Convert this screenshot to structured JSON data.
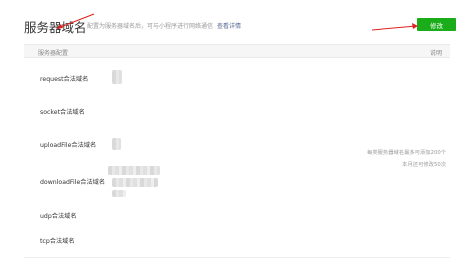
{
  "header": {
    "title": "服务器域名",
    "description": "配置为服务器域名后，可与小程序进行网络通信",
    "link": "查看详情",
    "modify_button": "修改"
  },
  "table": {
    "col_left": "服务器配置",
    "col_right": "说明",
    "rows": [
      {
        "label": "request合法域名"
      },
      {
        "label": "socket合法域名"
      },
      {
        "label": "uploadFile合法域名"
      },
      {
        "label": "downloadFile合法域名"
      },
      {
        "label": "udp合法域名"
      },
      {
        "label": "tcp合法域名"
      }
    ],
    "note_line1": "每类服务器域名最多可添加200个",
    "note_line2": "本月还可修改50次"
  },
  "colors": {
    "button_green": "#1aad19",
    "link_blue": "#576b95",
    "annotation_red": "#e0201f"
  }
}
